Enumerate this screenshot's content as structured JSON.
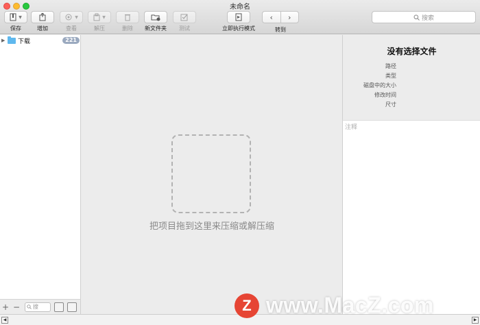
{
  "window": {
    "title": "未命名"
  },
  "toolbar": {
    "save": "保存",
    "add": "增加",
    "view": "查看",
    "extract": "解压",
    "delete": "删除",
    "new_folder": "新文件夹",
    "test": "测试",
    "run_now": "立即执行模式",
    "goto": "转到",
    "nav_back": "‹",
    "nav_forward": "›"
  },
  "search": {
    "placeholder": "搜索"
  },
  "sidebar": {
    "items": [
      {
        "label": "下载",
        "count": "221"
      }
    ],
    "bottom": {
      "add": "+",
      "remove": "−",
      "search_placeholder": "搜"
    }
  },
  "main": {
    "drop_hint": "把项目拖到这里来压缩或解压缩"
  },
  "info": {
    "title": "没有选择文件",
    "labels": [
      "路径",
      "类型",
      "磁盘中的大小",
      "修改时间",
      "尺寸"
    ],
    "notes_placeholder": "注释"
  },
  "watermark": {
    "logo": "Z",
    "text": "www.MacZ.com"
  },
  "colors": {
    "close": "#fc5f57",
    "minimize": "#fdbc2e",
    "zoom": "#28c840",
    "badge": "#9aa9bf",
    "folder": "#5fb8ee",
    "logo": "#e64534"
  }
}
